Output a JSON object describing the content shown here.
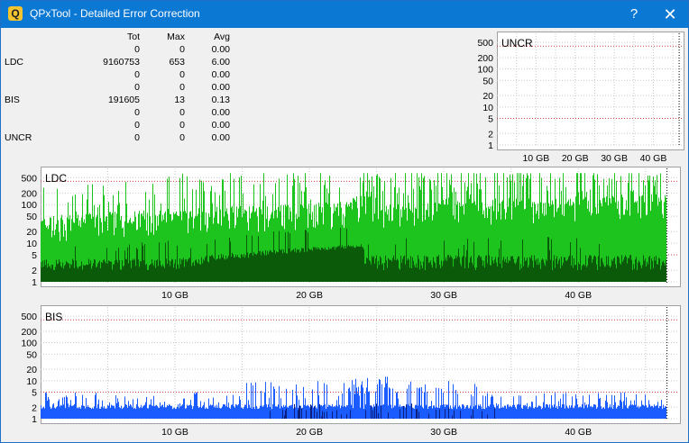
{
  "window": {
    "title": "QPxTool - Detailed Error Correction",
    "app_icon": "Q",
    "help_label": "?",
    "close_label": "✕"
  },
  "stats": {
    "headers": [
      "",
      "Tot",
      "Max",
      "Avg"
    ],
    "rows": [
      [
        "",
        "0",
        "0",
        "0.00"
      ],
      [
        "LDC",
        "9160753",
        "653",
        "6.00"
      ],
      [
        "",
        "0",
        "0",
        "0.00"
      ],
      [
        "",
        "0",
        "0",
        "0.00"
      ],
      [
        "BIS",
        "191605",
        "13",
        "0.13"
      ],
      [
        "",
        "0",
        "0",
        "0.00"
      ],
      [
        "",
        "0",
        "0",
        "0.00"
      ],
      [
        "UNCR",
        "0",
        "0",
        "0.00"
      ]
    ]
  },
  "colors": {
    "ldc_light": "#1ec41e",
    "ldc_dark": "#0a5a0a",
    "bis": "#1a5cff",
    "bis_dark": "#0b1f7a",
    "grid": "#c8c8c8",
    "threshold": "#d04040"
  },
  "chart_data": [
    {
      "type": "bar",
      "title": "UNCR",
      "y_ticks": [
        "500",
        "200",
        "100",
        "50",
        "20",
        "10",
        "5",
        "2",
        "1"
      ],
      "x_ticks": [
        "10 GB",
        "20 GB",
        "30 GB",
        "40 GB"
      ],
      "xlim": [
        0,
        47.5
      ],
      "y_scale": "log",
      "series": [
        {
          "values": []
        }
      ]
    },
    {
      "type": "bar",
      "title": "LDC",
      "y_ticks": [
        "500",
        "200",
        "100",
        "50",
        "20",
        "10",
        "5",
        "2",
        "1"
      ],
      "x_ticks": [
        "10 GB",
        "20 GB",
        "30 GB",
        "40 GB"
      ],
      "xlim": [
        0,
        47.5
      ],
      "y_scale": "log",
      "data_end_gb": 46.6,
      "max": 653
    },
    {
      "type": "bar",
      "title": "BIS",
      "y_ticks": [
        "500",
        "200",
        "100",
        "50",
        "20",
        "10",
        "5",
        "2",
        "1"
      ],
      "x_ticks": [
        "10 GB",
        "20 GB",
        "30 GB",
        "40 GB"
      ],
      "xlim": [
        0,
        47.5
      ],
      "y_scale": "log",
      "data_end_gb": 46.6,
      "max": 13
    }
  ]
}
